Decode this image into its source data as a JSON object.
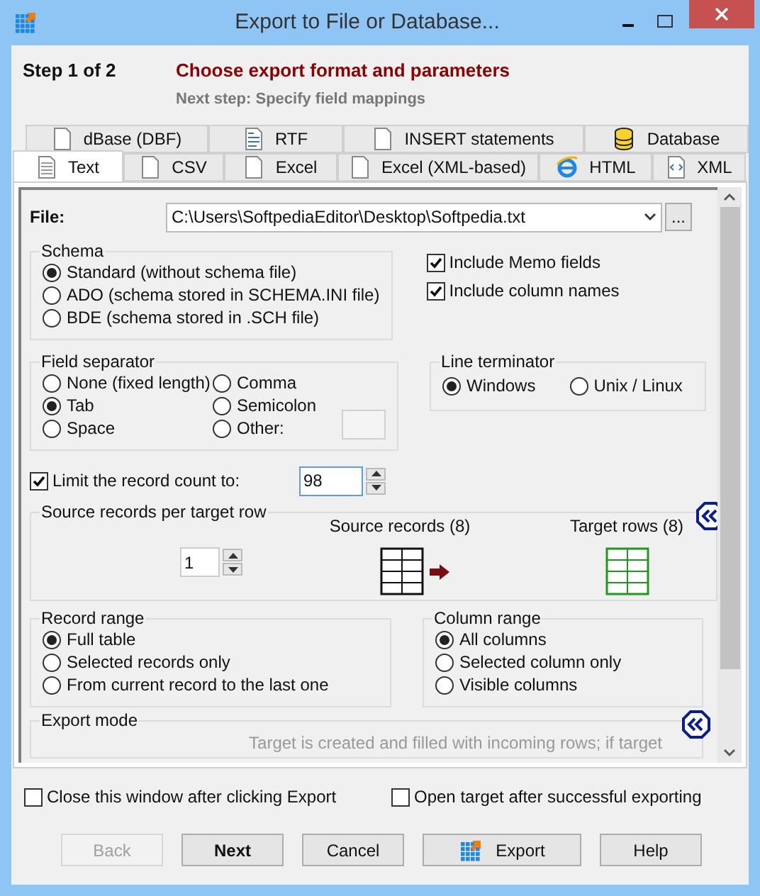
{
  "window": {
    "title": "Export to File or Database..."
  },
  "header": {
    "step": "Step 1 of 2",
    "title": "Choose export format and parameters",
    "next_step": "Next step: Specify field mappings"
  },
  "tabs": {
    "back_row": [
      {
        "label": "dBase (DBF)",
        "kind": "doc",
        "selected": false
      },
      {
        "label": "RTF",
        "kind": "rtf",
        "selected": false
      },
      {
        "label": "INSERT statements",
        "kind": "doc",
        "selected": false
      },
      {
        "label": "Database",
        "kind": "db",
        "selected": false
      }
    ],
    "front_row": [
      {
        "label": "Text",
        "kind": "lined",
        "selected": true
      },
      {
        "label": "CSV",
        "kind": "doc",
        "selected": false
      },
      {
        "label": "Excel",
        "kind": "doc",
        "selected": false
      },
      {
        "label": "Excel (XML-based)",
        "kind": "doc",
        "selected": false
      },
      {
        "label": "HTML",
        "kind": "web",
        "selected": false
      },
      {
        "label": "XML",
        "kind": "xml",
        "selected": false
      }
    ]
  },
  "file": {
    "label": "File:",
    "value": "C:\\Users\\SoftpediaEditor\\Desktop\\Softpedia.txt",
    "browse": "..."
  },
  "schema": {
    "title": "Schema",
    "options": [
      {
        "label": "Standard (without schema file)",
        "selected": true
      },
      {
        "label": "ADO (schema stored in SCHEMA.INI file)",
        "selected": false
      },
      {
        "label": "BDE (schema stored in .SCH file)",
        "selected": false
      }
    ]
  },
  "include_options": [
    {
      "label": "Include Memo fields",
      "checked": true
    },
    {
      "label": "Include column names",
      "checked": true
    }
  ],
  "field_separator": {
    "title": "Field separator",
    "options": [
      {
        "label": "None (fixed length)",
        "selected": false
      },
      {
        "label": "Comma",
        "selected": false
      },
      {
        "label": "Tab",
        "selected": true
      },
      {
        "label": "Semicolon",
        "selected": false
      },
      {
        "label": "Space",
        "selected": false
      },
      {
        "label": "Other:",
        "selected": false
      }
    ]
  },
  "line_terminator": {
    "title": "Line terminator",
    "options": [
      {
        "label": "Windows",
        "selected": true
      },
      {
        "label": "Unix / Linux",
        "selected": false
      }
    ]
  },
  "limit": {
    "label": "Limit the record count to:",
    "checked": true,
    "value": "98"
  },
  "source_records": {
    "title": "Source records per target row",
    "value": "1",
    "source_label": "Source records (8)",
    "target_label": "Target rows (8)"
  },
  "record_range": {
    "title": "Record range",
    "options": [
      {
        "label": "Full table",
        "selected": true
      },
      {
        "label": "Selected records only",
        "selected": false
      },
      {
        "label": "From current record to the last one",
        "selected": false
      }
    ]
  },
  "column_range": {
    "title": "Column range",
    "options": [
      {
        "label": "All columns",
        "selected": true
      },
      {
        "label": "Selected column only",
        "selected": false
      },
      {
        "label": "Visible columns",
        "selected": false
      }
    ]
  },
  "export_mode": {
    "title": "Export mode",
    "description": "Target is created and filled with incoming rows; if target"
  },
  "footer_options": [
    {
      "label": "Close this window after clicking Export",
      "checked": false
    },
    {
      "label": "Open target after successful exporting",
      "checked": false
    }
  ],
  "buttons": [
    {
      "label": "Back",
      "kind": "plain",
      "disabled": true
    },
    {
      "label": "Next",
      "kind": "default",
      "disabled": false
    },
    {
      "label": "Cancel",
      "kind": "plain",
      "disabled": false
    },
    {
      "label": "Export",
      "kind": "icon",
      "disabled": false
    },
    {
      "label": "Help",
      "kind": "plain",
      "disabled": false
    }
  ]
}
